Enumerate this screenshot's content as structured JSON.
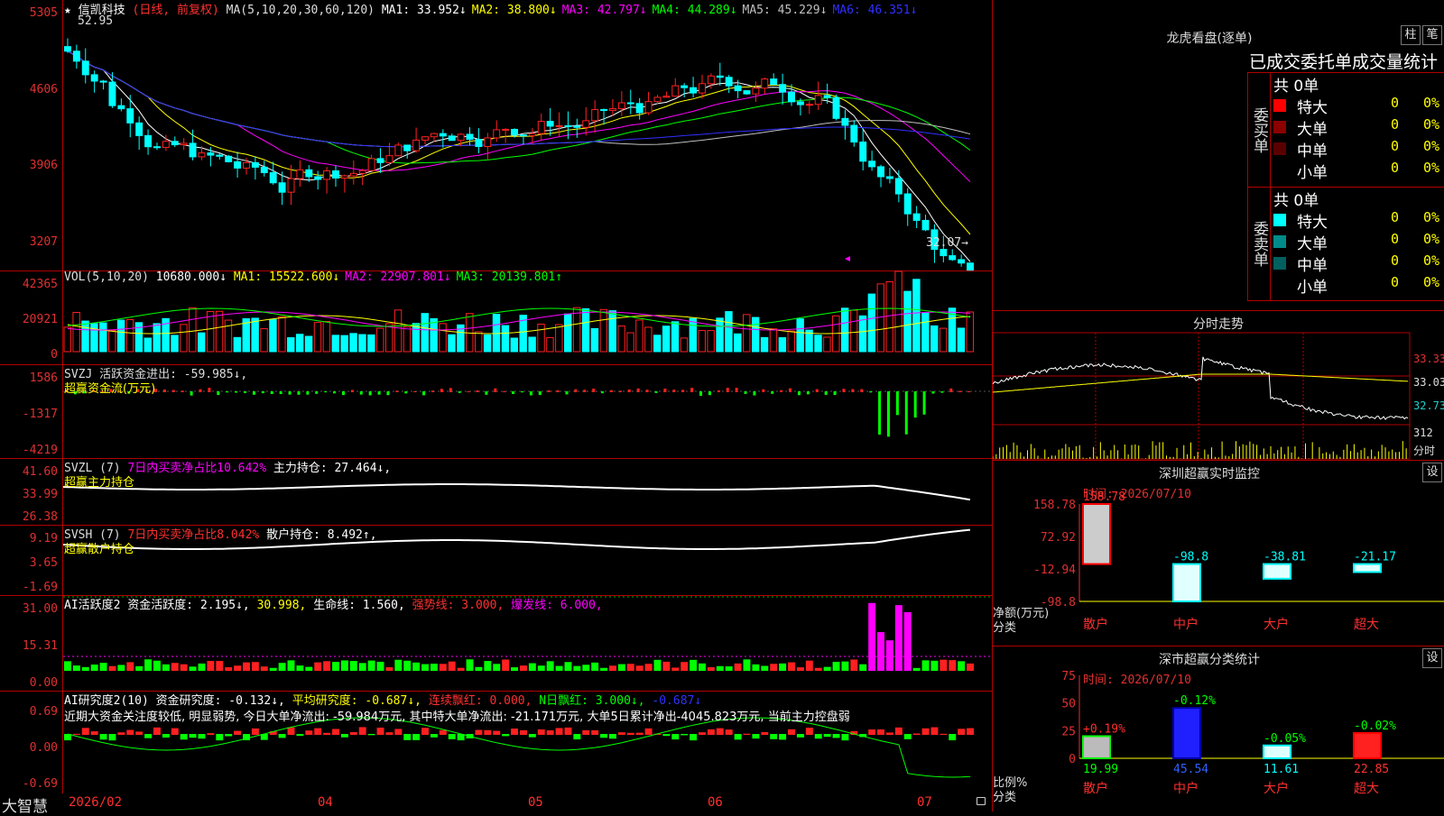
{
  "main": {
    "stock": "信凯科技",
    "mode": "(日线, 前复权)",
    "ma_title": "MA(5,10,20,30,60,120)",
    "ma": [
      {
        "label": "MA1: 33.952↓",
        "color": "#ffffff"
      },
      {
        "label": "MA2: 38.800↓",
        "color": "#ffff00"
      },
      {
        "label": "MA3: 42.797↓",
        "color": "#ff00ff"
      },
      {
        "label": "MA4: 44.289↓",
        "color": "#00ff00"
      },
      {
        "label": "MA5: 45.229↓",
        "color": "#c0c0c0"
      },
      {
        "label": "MA6: 46.351↓",
        "color": "#3030ff"
      }
    ],
    "high_label": "52.95",
    "low_label": "32.07→",
    "yticks": [
      "5305",
      "4606",
      "3906",
      "3207"
    ]
  },
  "vol": {
    "title": "VOL(5,10,20)",
    "value": "10680.000↓",
    "mas": [
      {
        "label": "MA1: 15522.600↓",
        "color": "#ffff00"
      },
      {
        "label": "MA2: 22907.801↓",
        "color": "#ff00ff"
      },
      {
        "label": "MA3: 20139.801↑",
        "color": "#00ff00"
      }
    ],
    "yticks": [
      "42365",
      "20921",
      "0"
    ]
  },
  "svzj": {
    "title": "SVZJ  活跃资金进出: -59.985↓,",
    "sub": "超赢资金流(万元)",
    "yticks": [
      "1586",
      "-1317",
      "-4219"
    ]
  },
  "svzl": {
    "title": "SVZL (7)",
    "pct": "7日内买卖净占比10.642%",
    "hold": "主力持仓: 27.464↓,",
    "sub": "超赢主力持仓",
    "yticks": [
      "41.60",
      "33.99",
      "26.38"
    ]
  },
  "svsh": {
    "title": "SVSH (7)",
    "pct": "7日内买卖净占比8.042%",
    "hold": "散户持仓: 8.492↑,",
    "sub": "超赢散户持仓",
    "yticks": [
      "9.19",
      "3.65",
      "-1.69"
    ]
  },
  "ai1": {
    "title": "AI活跃度2 资金活跃度: 2.195↓,",
    "v2": "30.998,",
    "life": "生命线: 1.560,",
    "strong": "强势线: 3.000,",
    "burst": "爆发线: 6.000,",
    "yticks": [
      "31.00",
      "15.31",
      "0.00"
    ]
  },
  "ai2": {
    "title": "AI研究度2(10) 资金研究度: -0.132↓,",
    "avg": "平均研究度: -0.687↓,",
    "lx": "连续飘红: 0.000,",
    "nday": "N日飘红: 3.000↓,",
    "neg": "-0.687↓",
    "comment": "近期大资金关注度较低, 明显弱势, 今日大单净流出: -59.984万元, 其中特大单净流出: -21.171万元, 大单5日累计净出-4045.823万元, 当前主力控盘弱",
    "yticks": [
      "0.69",
      "0.00",
      "-0.69"
    ]
  },
  "xaxis": [
    "2026/02",
    "04",
    "05",
    "06",
    "07"
  ],
  "brand": "大智慧",
  "lhb": {
    "title": "龙虎看盘(逐单)",
    "btn1": "柱",
    "btn2": "笔",
    "heading": "已成交委托单成交量统计",
    "buy_side": "委买单",
    "sell_side": "委卖单",
    "buy_total": "共 0单",
    "sell_total": "共 0单",
    "buy_rows": [
      {
        "name": "特大",
        "qty": "0",
        "pct": "0%",
        "color": "#ff0000"
      },
      {
        "name": "大单",
        "qty": "0",
        "pct": "0%",
        "color": "#8b0000"
      },
      {
        "name": "中单",
        "qty": "0",
        "pct": "0%",
        "color": "#5a0000"
      },
      {
        "name": "小单",
        "qty": "0",
        "pct": "0%",
        "color": "#000000"
      }
    ],
    "sell_rows": [
      {
        "name": "特大",
        "qty": "0",
        "pct": "0%",
        "color": "#00ffff"
      },
      {
        "name": "大单",
        "qty": "0",
        "pct": "0%",
        "color": "#008b8b"
      },
      {
        "name": "中单",
        "qty": "0",
        "pct": "0%",
        "color": "#006060"
      },
      {
        "name": "小单",
        "qty": "0",
        "pct": "0%",
        "color": "#000000"
      }
    ]
  },
  "intraday": {
    "title": "分时走势",
    "prices": [
      "33.33",
      "33.03",
      "32.73"
    ],
    "vol": "312",
    "unit": "分时"
  },
  "monitor": {
    "title": "深圳超赢实时监控",
    "btn": "设",
    "time": "时间: 2026/07/10",
    "yticks": [
      "158.78",
      "72.92",
      "-12.94",
      "-98.8"
    ],
    "ylabel1": "净额(万元)",
    "ylabel2": "分类",
    "cats": [
      "散户",
      "中户",
      "大户",
      "超大"
    ],
    "values": [
      158.78,
      -98.8,
      -38.81,
      -21.17
    ],
    "labels": [
      "158.78",
      "-98.8",
      "-38.81",
      "-21.17"
    ]
  },
  "classstat": {
    "title": "深市超赢分类统计",
    "btn": "设",
    "time": "时间: 2026/07/10",
    "yticks": [
      "75",
      "50",
      "25",
      "0"
    ],
    "ylabel1": "比例%",
    "ylabel2": "分类",
    "cats": [
      "散户",
      "中户",
      "大户",
      "超大"
    ],
    "values": [
      19.99,
      45.54,
      11.61,
      22.85
    ],
    "vlabels": [
      "19.99",
      "45.54",
      "11.61",
      "22.85"
    ],
    "deltas": [
      "+0.19%",
      "-0.12%",
      "-0.05%",
      "-0.02%"
    ]
  }
}
